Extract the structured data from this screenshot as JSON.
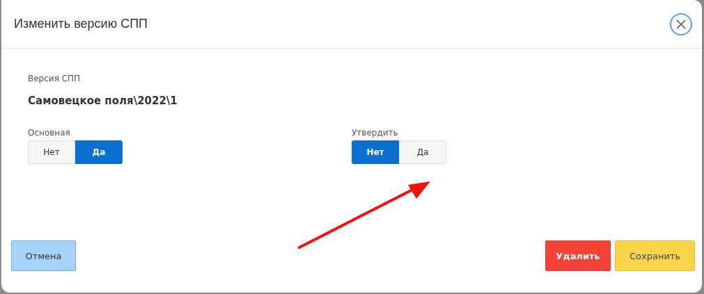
{
  "dialog": {
    "title": "Изменить версию СПП"
  },
  "version": {
    "label": "Версия СПП",
    "value": "Самовецкое поля\\2022\\1"
  },
  "toggles": [
    {
      "label": "Основная",
      "options": [
        {
          "label": "Нет",
          "selected": false
        },
        {
          "label": "Да",
          "selected": true
        }
      ]
    },
    {
      "label": "Утвердить",
      "options": [
        {
          "label": "Нет",
          "selected": true
        },
        {
          "label": "Да",
          "selected": false
        }
      ]
    }
  ],
  "buttons": [
    {
      "label": "Отмена",
      "kind": "cancel"
    },
    {
      "label": "Удалить",
      "kind": "danger"
    },
    {
      "label": "Сохранить",
      "kind": "save"
    }
  ]
}
